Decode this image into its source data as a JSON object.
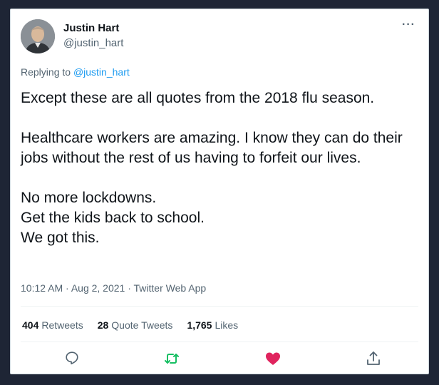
{
  "author": {
    "name": "Justin Hart",
    "handle": "@justin_hart",
    "more_label": "···"
  },
  "reply": {
    "prefix": "Replying to ",
    "handle": "@justin_hart"
  },
  "tweet": {
    "line1": "Except these are all quotes from the 2018 flu season.",
    "line2": "Healthcare workers are amazing. I know they can do their jobs without the rest of us having to forfeit our lives.",
    "line3a": "No more lockdowns.",
    "line3b": "Get the kids back to school.",
    "line3c": "We got this."
  },
  "meta": {
    "text": "10:12 AM · Aug 2, 2021 · Twitter Web App"
  },
  "stats": {
    "retweets_count": "404",
    "retweets_label": "Retweets",
    "quotes_count": "28",
    "quotes_label": "Quote Tweets",
    "likes_count": "1,765",
    "likes_label": "Likes"
  },
  "icons": {
    "reply": "reply-icon",
    "retweet": "retweet-icon",
    "like": "heart-icon",
    "share": "share-icon"
  },
  "colors": {
    "retweet": "#17bf63",
    "like": "#e0245e",
    "link": "#1d9bf0",
    "muted": "#536471"
  }
}
